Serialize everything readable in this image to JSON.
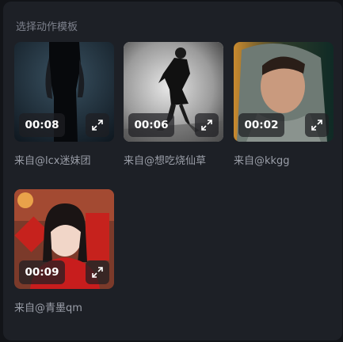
{
  "panel": {
    "title": "选择动作模板"
  },
  "templates": [
    {
      "duration": "00:08",
      "caption": "来自@lcx迷妹团",
      "selected": false
    },
    {
      "duration": "00:06",
      "caption": "来自@想吃烧仙草",
      "selected": true
    },
    {
      "duration": "00:02",
      "caption": "来自@kkgg",
      "selected": false
    },
    {
      "duration": "00:09",
      "caption": "来自@青墨qm",
      "selected": false
    }
  ],
  "icons": {
    "expand": "expand-icon"
  },
  "colors": {
    "panel_bg": "#1d2026",
    "selected_border": "#f2f2f2",
    "caption_text": "#9a9ea8",
    "title_text": "#7d818c"
  }
}
